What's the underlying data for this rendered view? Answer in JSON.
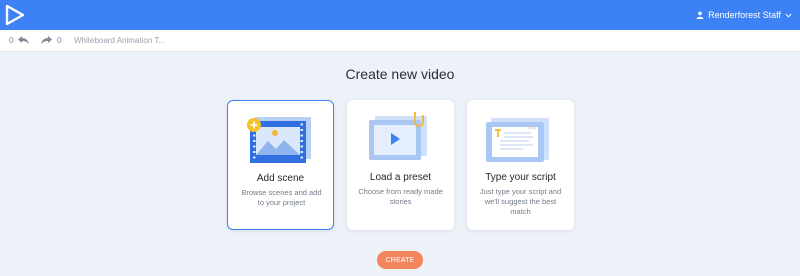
{
  "header": {
    "user_name": "Renderforest Staff"
  },
  "toolbar": {
    "undo_count": "0",
    "redo_count": "0",
    "project_title": "Whiteboard Animation T..."
  },
  "main": {
    "heading": "Create new video",
    "cards": [
      {
        "title": "Add scene",
        "description": "Browse scenes and add to your project",
        "icon": "add-scene-icon",
        "selected": true
      },
      {
        "title": "Load a preset",
        "description": "Choose from ready made stories",
        "icon": "load-preset-icon",
        "selected": false
      },
      {
        "title": "Type your script",
        "description": "Just type your script and we'll suggest the best match",
        "icon": "type-script-icon",
        "selected": false
      }
    ],
    "create_label": "CREATE"
  },
  "colors": {
    "accent": "#3d82f5",
    "create_button": "#f5855c",
    "background": "#edf1f8"
  }
}
